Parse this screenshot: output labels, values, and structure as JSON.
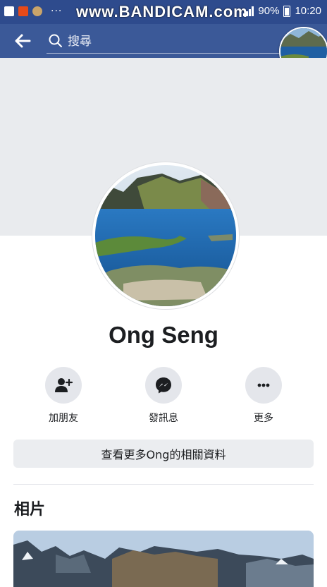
{
  "status_bar": {
    "watermark": "www.BANDICAM.com",
    "battery": "90%",
    "time": "10:20",
    "dots": "···"
  },
  "search": {
    "placeholder": "搜尋"
  },
  "profile": {
    "name": "Ong Seng"
  },
  "actions": [
    {
      "label": "加朋友",
      "icon": "add-friend-icon"
    },
    {
      "label": "發訊息",
      "icon": "messenger-icon"
    },
    {
      "label": "更多",
      "icon": "more-icon"
    }
  ],
  "more_info_label": "查看更多Ong的相關資料",
  "photos": {
    "title": "相片"
  },
  "colors": {
    "app_bar": "#3b5998",
    "status_bar": "#2e4b8d",
    "button_bg": "#e4e6eb"
  }
}
